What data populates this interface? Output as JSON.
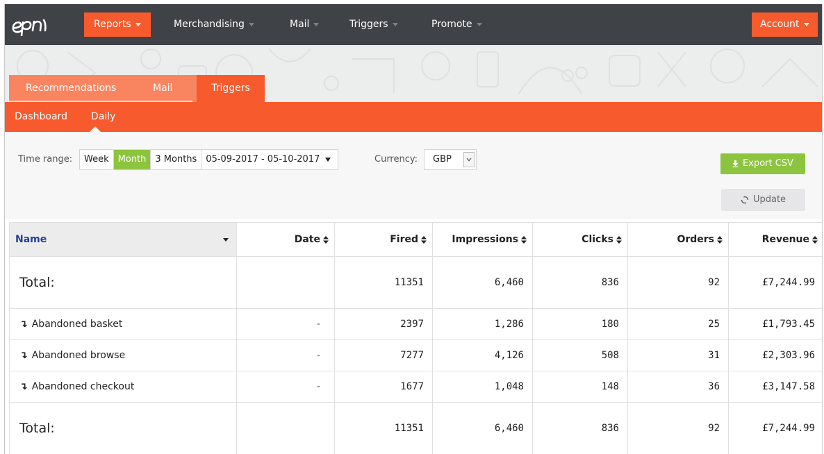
{
  "nav": {
    "logo": "epi",
    "items": [
      {
        "label": "Reports",
        "active": true
      },
      {
        "label": "Merchandising",
        "active": false
      },
      {
        "label": "Mail",
        "active": false
      },
      {
        "label": "Triggers",
        "active": false
      },
      {
        "label": "Promote",
        "active": false
      }
    ],
    "account": "Account"
  },
  "tabs": [
    "Recommendations",
    "Mail",
    "Triggers"
  ],
  "active_tab": "Triggers",
  "subtabs": [
    "Dashboard",
    "Daily"
  ],
  "active_subtab": "Daily",
  "filters": {
    "time_range_label": "Time range:",
    "ranges": [
      "Week",
      "Month",
      "3 Months"
    ],
    "active_range": "Month",
    "date_range": "05-09-2017 - 05-10-2017",
    "currency_label": "Currency:",
    "currency": "GBP",
    "export_label": "Export CSV",
    "update_label": "Update"
  },
  "table": {
    "headers": [
      "Name",
      "Date",
      "Fired",
      "Impressions",
      "Clicks",
      "Orders",
      "Revenue"
    ],
    "top_total": {
      "label": "Total:",
      "fired": "11351",
      "impressions": "6,460",
      "clicks": "836",
      "orders": "92",
      "revenue": "£7,244.99"
    },
    "rows": [
      {
        "name": "Abandoned basket",
        "date": "-",
        "fired": "2397",
        "impressions": "1,286",
        "clicks": "180",
        "orders": "25",
        "revenue": "£1,793.45"
      },
      {
        "name": "Abandoned browse",
        "date": "-",
        "fired": "7277",
        "impressions": "4,126",
        "clicks": "508",
        "orders": "31",
        "revenue": "£2,303.96"
      },
      {
        "name": "Abandoned checkout",
        "date": "-",
        "fired": "1677",
        "impressions": "1,048",
        "clicks": "148",
        "orders": "36",
        "revenue": "£3,147.58"
      }
    ],
    "bottom_total": {
      "label": "Total:",
      "fired": "11351",
      "impressions": "6,460",
      "clicks": "836",
      "orders": "92",
      "revenue": "£7,244.99"
    }
  },
  "colors": {
    "nav_bg": "#3f4347",
    "accent": "#f75a2c",
    "tab_light": "#f98560",
    "green": "#8dc43f",
    "name_header": "#1d3f9a"
  }
}
